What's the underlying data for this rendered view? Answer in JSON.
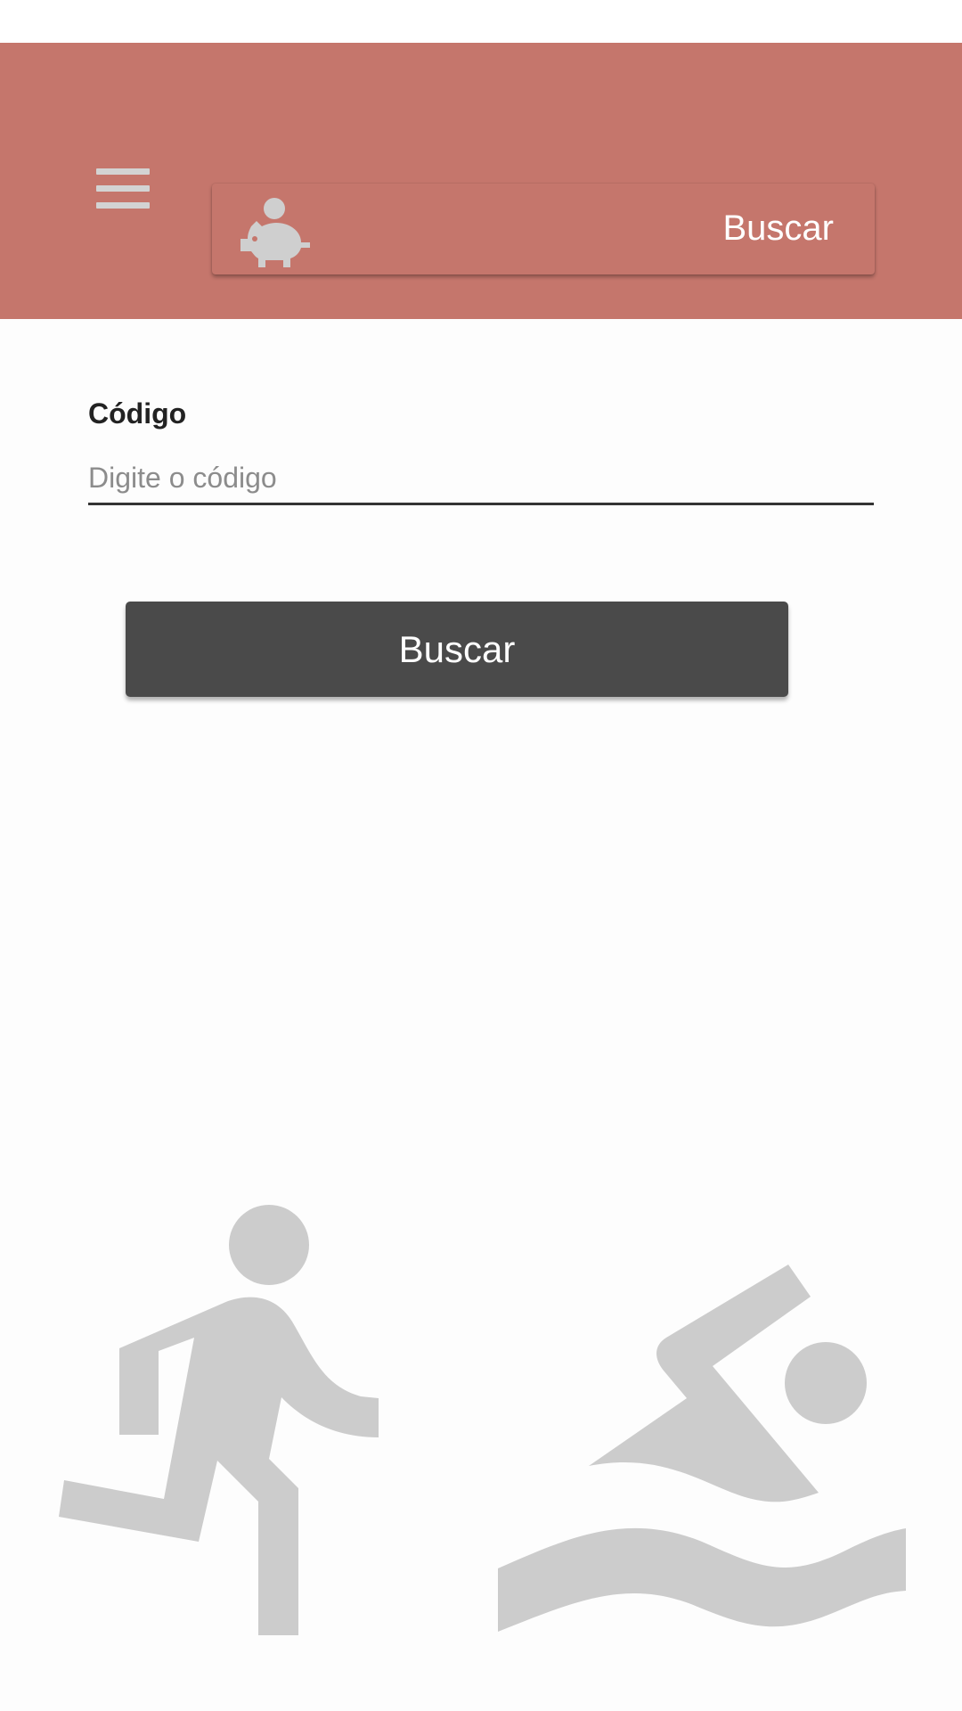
{
  "app": {
    "search_bar_label": "Buscar",
    "logo_icon": "piggy-bank-icon",
    "menu_icon": "hamburger-menu-icon"
  },
  "form": {
    "code_label": "Código",
    "code_placeholder": "Digite o código",
    "code_value": "",
    "submit_label": "Buscar"
  },
  "decorations": {
    "left_icon": "running-person-icon",
    "right_icon": "swimmer-icon"
  },
  "colors": {
    "appbar": "#c5766c",
    "button": "#4a4a4a",
    "icon_gray": "#cccccc"
  }
}
